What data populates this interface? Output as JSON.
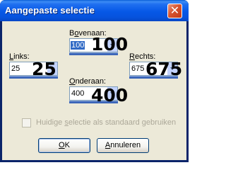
{
  "window": {
    "title": "Aangepaste selectie",
    "close_glyph": "✕"
  },
  "fields": {
    "top": {
      "label_pre": "B",
      "label_key": "o",
      "label_post": "venaan:",
      "value": "100",
      "big": "100"
    },
    "left": {
      "label_pre": "",
      "label_key": "L",
      "label_post": "inks:",
      "value": "25",
      "big": "25"
    },
    "right": {
      "label_pre": "",
      "label_key": "R",
      "label_post": "echts:",
      "value": "675",
      "big": "675"
    },
    "bottom": {
      "label_pre": "",
      "label_key": "O",
      "label_post": "nderaan:",
      "value": "400",
      "big": "400"
    }
  },
  "checkbox": {
    "label_pre": "Huidige ",
    "label_key": "s",
    "label_post": "electie als standaard gebruiken",
    "checked": false
  },
  "buttons": {
    "ok": {
      "label_key": "O",
      "label_post": "K"
    },
    "cancel": {
      "label_pre": "",
      "label_key": "A",
      "label_post": "nnuleren"
    }
  },
  "colors": {
    "title_bar": "#0658e6",
    "dialog_bg": "#ece9d8",
    "selection": "#316ac5",
    "close_button": "#d8542f"
  }
}
